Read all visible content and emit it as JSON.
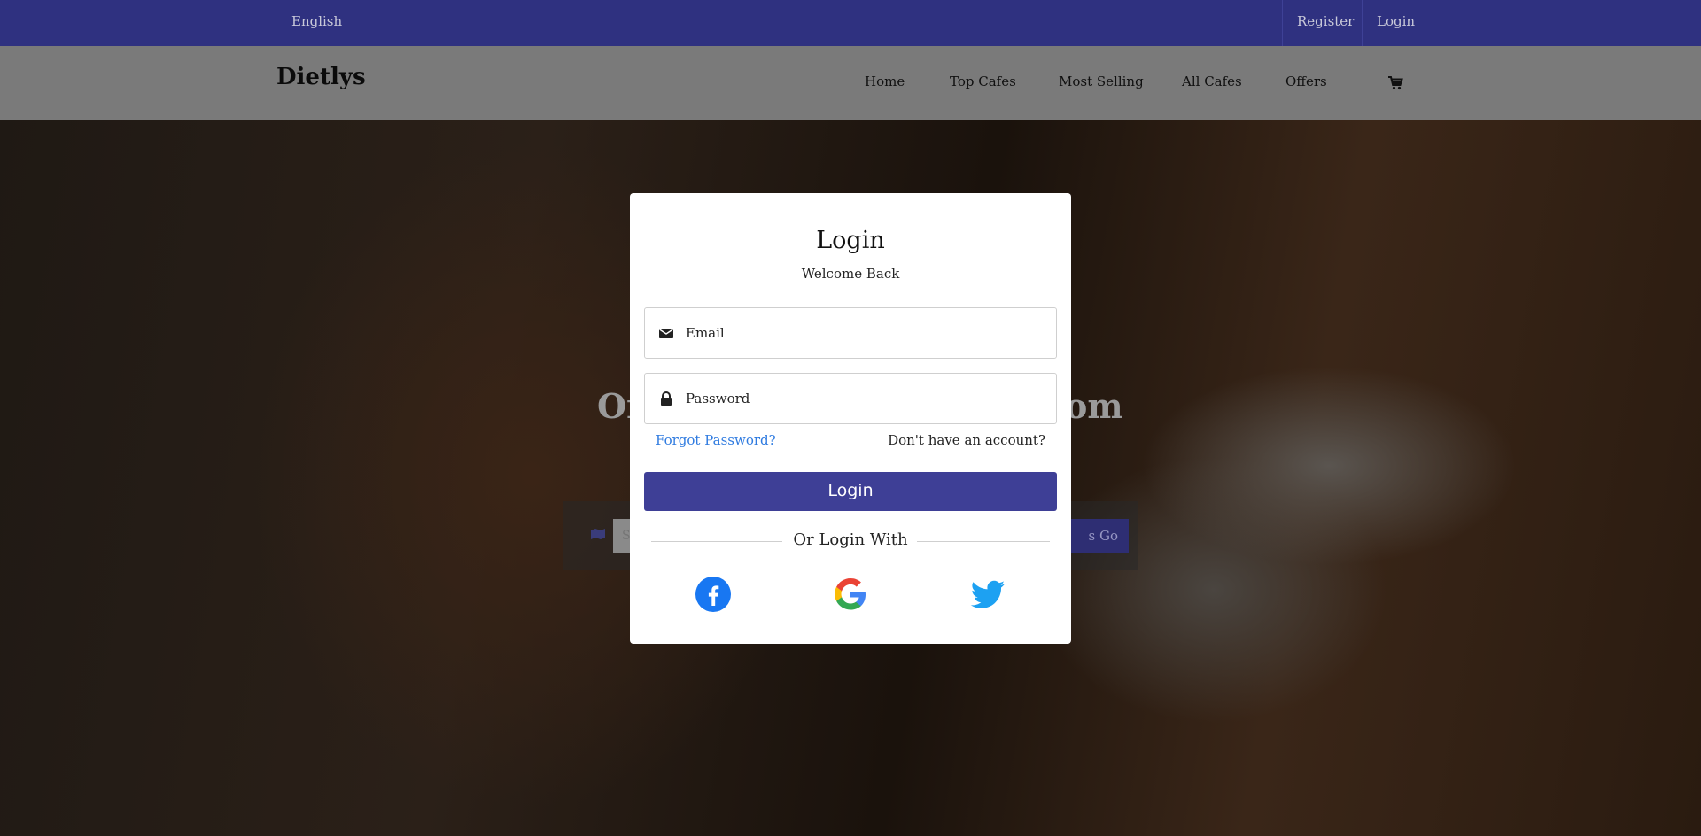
{
  "topbar": {
    "language": "English",
    "register": "Register",
    "login": "Login"
  },
  "navbar": {
    "brand": "Dietlys",
    "items": [
      {
        "label": "Home"
      },
      {
        "label": "Top Cafes"
      },
      {
        "label": "Most Selling"
      },
      {
        "label": "All Cafes"
      },
      {
        "label": "Offers"
      }
    ],
    "cart_icon": "shopping-cart-icon"
  },
  "hero": {
    "title_start": "Or",
    "title_end": "om",
    "search_placeholder": "S",
    "go_label": "s Go",
    "map_icon": "map-icon"
  },
  "modal": {
    "title": "Login",
    "subtitle": "Welcome Back",
    "email_placeholder": "Email",
    "password_placeholder": "Password",
    "forgot": "Forgot Password?",
    "no_account": "Don't have an account?",
    "login_button": "Login",
    "or_login_with": "Or Login With",
    "social": [
      "facebook-icon",
      "google-icon",
      "twitter-icon"
    ]
  },
  "colors": {
    "topbar": "#2f3180",
    "primary_button": "#3e3f96",
    "link": "#2f7be0"
  }
}
